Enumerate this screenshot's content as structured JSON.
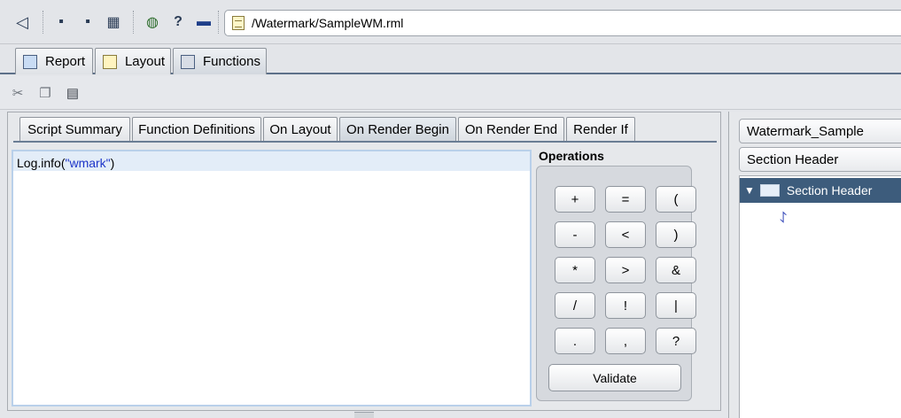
{
  "toolbar": {
    "path": "/Watermark/SampleWM.rml",
    "buttons": [
      {
        "icon": "back-arrow-icon",
        "glyph": "◁"
      },
      {
        "icon": "save-icon",
        "glyph": "▪"
      },
      {
        "icon": "save-as-icon",
        "glyph": "▪"
      },
      {
        "icon": "properties-icon",
        "glyph": "▦"
      },
      {
        "icon": "globe-icon",
        "glyph": "◍"
      },
      {
        "icon": "help-icon",
        "glyph": "?"
      },
      {
        "icon": "preview-icon",
        "glyph": "▬"
      }
    ]
  },
  "main_tabs": [
    {
      "label": "Report",
      "active": false
    },
    {
      "label": "Layout",
      "active": false
    },
    {
      "label": "Functions",
      "active": true
    }
  ],
  "edit_buttons": [
    "cut-icon",
    "copy-icon",
    "paste-icon"
  ],
  "script_tabs": [
    {
      "label": "Script Summary",
      "active": false
    },
    {
      "label": "Function Definitions",
      "active": false
    },
    {
      "label": "On Layout",
      "active": false
    },
    {
      "label": "On Render Begin",
      "active": true
    },
    {
      "label": "On Render End",
      "active": false
    },
    {
      "label": "Render If",
      "active": false
    }
  ],
  "editor": {
    "code_prefix": "Log.info(",
    "code_string": "\"wmark\"",
    "code_suffix": ")"
  },
  "operations": {
    "title": "Operations",
    "keys": [
      "+",
      "=",
      "(",
      "-",
      "<",
      ")",
      "*",
      ">",
      "&",
      "/",
      "!",
      "|",
      ".",
      ",",
      "?"
    ],
    "validate_label": "Validate"
  },
  "right": {
    "combo1": "Watermark_Sample",
    "combo2": "Section Header",
    "tree_item": "Section Header"
  },
  "colors": {
    "selected_row": "#3d5c7c",
    "string_literal": "#1d35c9"
  }
}
